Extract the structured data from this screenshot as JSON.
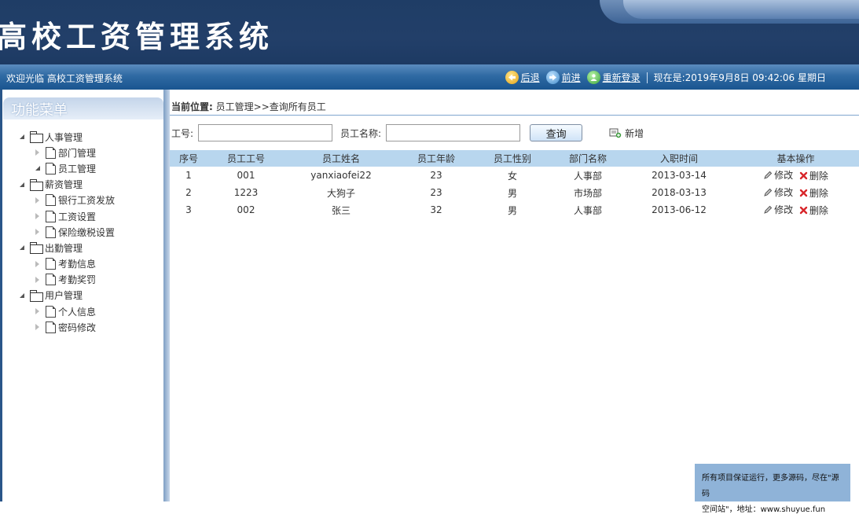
{
  "header": {
    "app_title": "高校工资管理系统"
  },
  "statusbar": {
    "welcome": "欢迎光临 高校工资管理系统",
    "back_label": "后退",
    "forward_label": "前进",
    "relogin_label": "重新登录",
    "datetime": "现在是:2019年9月8日 09:42:06 星期日"
  },
  "sidebar": {
    "title": "功能菜单",
    "groups": [
      {
        "label": "人事管理",
        "items": [
          "部门管理",
          "员工管理"
        ]
      },
      {
        "label": "薪资管理",
        "items": [
          "银行工资发放",
          "工资设置",
          "保险缴税设置"
        ]
      },
      {
        "label": "出勤管理",
        "items": [
          "考勤信息",
          "考勤奖罚"
        ]
      },
      {
        "label": "用户管理",
        "items": [
          "个人信息",
          "密码修改"
        ]
      }
    ]
  },
  "main": {
    "breadcrumb_label": "当前位置:",
    "breadcrumb_path": "员工管理>>查询所有员工",
    "search": {
      "id_label": "工号:",
      "id_value": "",
      "name_label": "员工名称:",
      "name_value": "",
      "query_label": "查询",
      "add_label": "新增"
    },
    "table": {
      "columns": [
        "序号",
        "员工工号",
        "员工姓名",
        "员工年龄",
        "员工性别",
        "部门名称",
        "入职时间",
        "基本操作"
      ],
      "rows": [
        [
          "1",
          "001",
          "yanxiaofei22",
          "23",
          "女",
          "人事部",
          "2013-03-14"
        ],
        [
          "2",
          "1223",
          "大狗子",
          "23",
          "男",
          "市场部",
          "2018-03-13"
        ],
        [
          "3",
          "002",
          "张三",
          "32",
          "男",
          "人事部",
          "2013-06-12"
        ]
      ],
      "edit_label": "修改",
      "delete_label": "删除"
    }
  },
  "footer_note": {
    "line1": "所有项目保证运行，更多源码，尽在\"源码",
    "line2": "空间站\"，地址：www.shuyue.fun"
  },
  "colors": {
    "banner": "#1f3d66",
    "statusbar": "#2f6aa3",
    "table_header": "#b8d6ee",
    "footer_note": "#8fb3d8"
  }
}
